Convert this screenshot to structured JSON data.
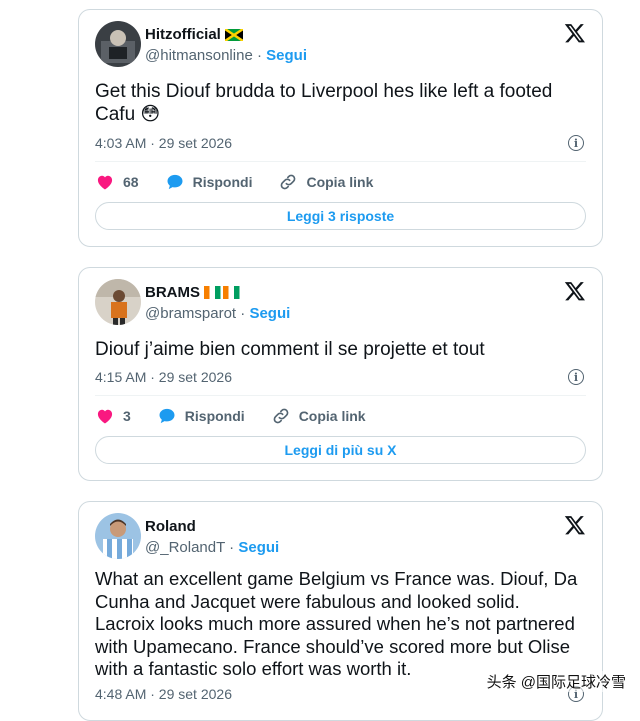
{
  "tweets": [
    {
      "name": "Hitzofficial",
      "handle": "@hitmansonline",
      "separator": "·",
      "follow_label": "Segui",
      "text": "Get this Diouf brudda to Liverpool hes like left a footed Cafu 😳",
      "time": "4:03 AM · 29 set 2026",
      "likes": "68",
      "reply_label": "Rispondi",
      "copy_label": "Copia link",
      "footer_label": "Leggi 3 risposte"
    },
    {
      "name": "BRAMS",
      "handle": "@bramsparot",
      "separator": "·",
      "follow_label": "Segui",
      "text": "Diouf j’aime bien comment il se projette et tout",
      "time": "4:15 AM · 29 set 2026",
      "likes": "3",
      "reply_label": "Rispondi",
      "copy_label": "Copia link",
      "footer_label": "Leggi di più su X"
    },
    {
      "name": "Roland",
      "handle": "@_RolandT",
      "separator": "·",
      "follow_label": "Segui",
      "text": "What an excellent game Belgium vs France was. Diouf, Da Cunha and Jacquet were fabulous and looked solid. Lacroix looks much more assured when he’s not partnered with Upamecano. France should’ve scored more but Olise with a fantastic solo effort was worth it.",
      "time": "4:48 AM · 29 set 2026"
    }
  ],
  "info_glyph": "i",
  "watermark": "头条 @国际足球冷雪",
  "colors": {
    "accent": "#1d9bf0",
    "like": "#f91880",
    "muted": "#536471",
    "border": "#cfd9de"
  },
  "icons": [
    "x-logo-icon",
    "heart-icon",
    "reply-bubble-icon",
    "link-icon",
    "info-icon",
    "jamaica-flag-icon",
    "ivory-coast-flag-icon"
  ]
}
